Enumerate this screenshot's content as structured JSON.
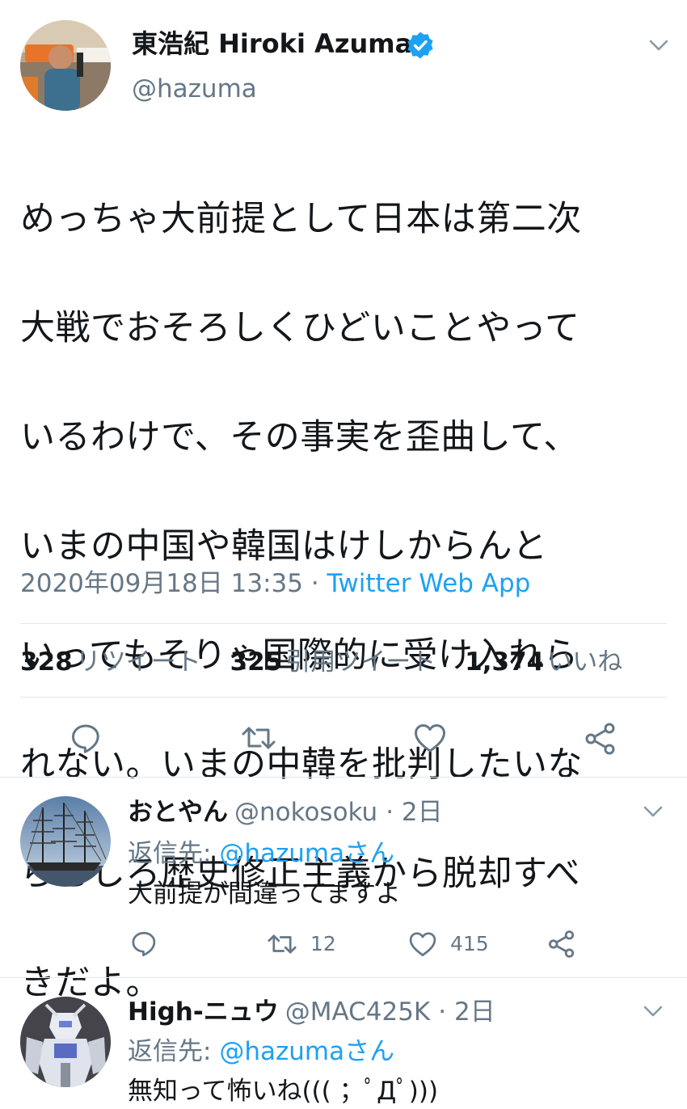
{
  "tweet": {
    "author": {
      "display_name": "東浩紀 Hiroki Azuma",
      "handle": "@hazuma",
      "verified": true
    },
    "text_lines": [
      "めっちゃ大前提として日本は第二次",
      "大戦でおそろしくひどいことやって",
      "いるわけで、その事実を歪曲して、",
      "いまの中国や韓国はけしからんと",
      "いってもそりゃ国際的に受け入れら",
      "れない。いまの中韓を批判したいな",
      "らむしろ歴史修正主義から脱却すべ",
      "きだよ。"
    ],
    "timestamp": "2020年09月18日 13:35",
    "separator": " · ",
    "source": "Twitter Web App",
    "stats": [
      {
        "count": "328",
        "label": "リツイート"
      },
      {
        "count": "325",
        "label": "引用ツイート"
      },
      {
        "count": "1,374",
        "label": "いいね"
      }
    ]
  },
  "replies": [
    {
      "display_name": "おとやん",
      "handle": "@nokosoku",
      "time": "· 2日",
      "reply_prefix": "返信先: ",
      "reply_to": "@hazumaさん",
      "text": "大前提が間違ってますよ",
      "retweets": "12",
      "likes": "415"
    },
    {
      "display_name": "High-ニュウ",
      "handle": "@MAC425K",
      "time": "· 2日",
      "reply_prefix": "返信先: ",
      "reply_to": "@hazumaさん",
      "text": "無知って怖いね((( ；ﾟДﾟ)))"
    }
  ],
  "colors": {
    "accent": "#1da1f2",
    "secondary_text": "#657786",
    "primary_text": "#14171a",
    "divider": "#e1e8ed",
    "icon": "#657786"
  }
}
